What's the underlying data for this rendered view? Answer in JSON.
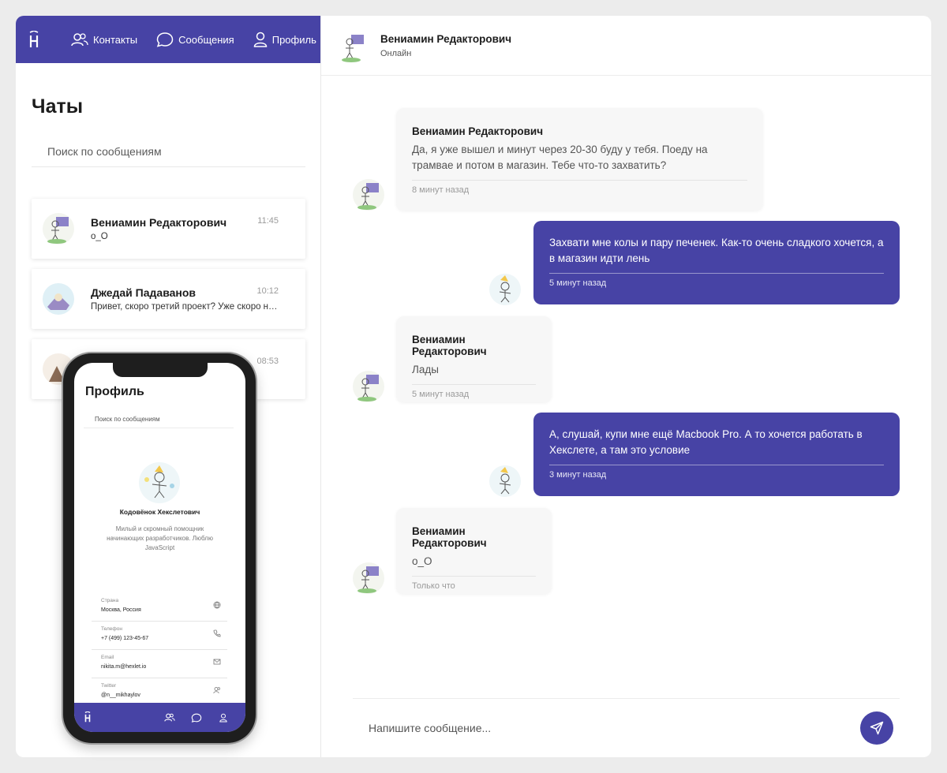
{
  "nav": {
    "contacts": "Контакты",
    "messages": "Сообщения",
    "profile": "Профиль"
  },
  "sidebar": {
    "title": "Чаты",
    "search_placeholder": "Поиск по сообщениям",
    "chats": [
      {
        "name": "Вениамин Редакторович",
        "preview": "o_O",
        "time": "11:45"
      },
      {
        "name": "Джедай Падаванов",
        "preview": "Привет, скоро третий проект? Уже скоро над...",
        "time": "10:12"
      },
      {
        "name": "",
        "preview": "",
        "time": "08:53"
      }
    ]
  },
  "header": {
    "name": "Вениамин Редакторович",
    "status": "Онлайн"
  },
  "messages": [
    {
      "dir": "in",
      "author": "Вениамин Редакторович",
      "text": "Да, я уже вышел и минут через 20-30 буду у тебя. Поеду на трамвае и потом в магазин. Тебе что-то захватить?",
      "time": "8 минут назад"
    },
    {
      "dir": "out",
      "text": "Захвати мне колы и пару печенек. Как-то очень сладкого хочется, а в магазин идти лень",
      "time": "5 минут назад"
    },
    {
      "dir": "in",
      "author": "Вениамин Редакторович",
      "text": "Лады",
      "time": "5 минут назад"
    },
    {
      "dir": "out",
      "text": "А, слушай, купи мне ещё Macbook Pro. А то хочется работать в Хекслете, а там это условие",
      "time": "3 минут назад"
    },
    {
      "dir": "in",
      "author": "Вениамин Редакторович",
      "text": "o_O",
      "time": "Только что"
    }
  ],
  "composer": {
    "placeholder": "Напишите сообщение..."
  },
  "phone": {
    "title": "Профиль",
    "search_placeholder": "Поиск по сообщениям",
    "name": "Кодовёнок Хекслетович",
    "bio": "Милый и скромный помощник начинающих разработчиков. Люблю JavaScript",
    "fields": [
      {
        "label": "Страна",
        "value": "Москва, Россия",
        "icon": "globe-icon"
      },
      {
        "label": "Телефон",
        "value": "+7 (499) 123-45-67",
        "icon": "phone-icon"
      },
      {
        "label": "Email",
        "value": "nikita.m@hexlet.io",
        "icon": "mail-icon"
      },
      {
        "label": "Twitter",
        "value": "@n__mikhaylov",
        "icon": "users-icon"
      }
    ]
  },
  "colors": {
    "accent": "#4743a5",
    "background": "#ececec"
  }
}
